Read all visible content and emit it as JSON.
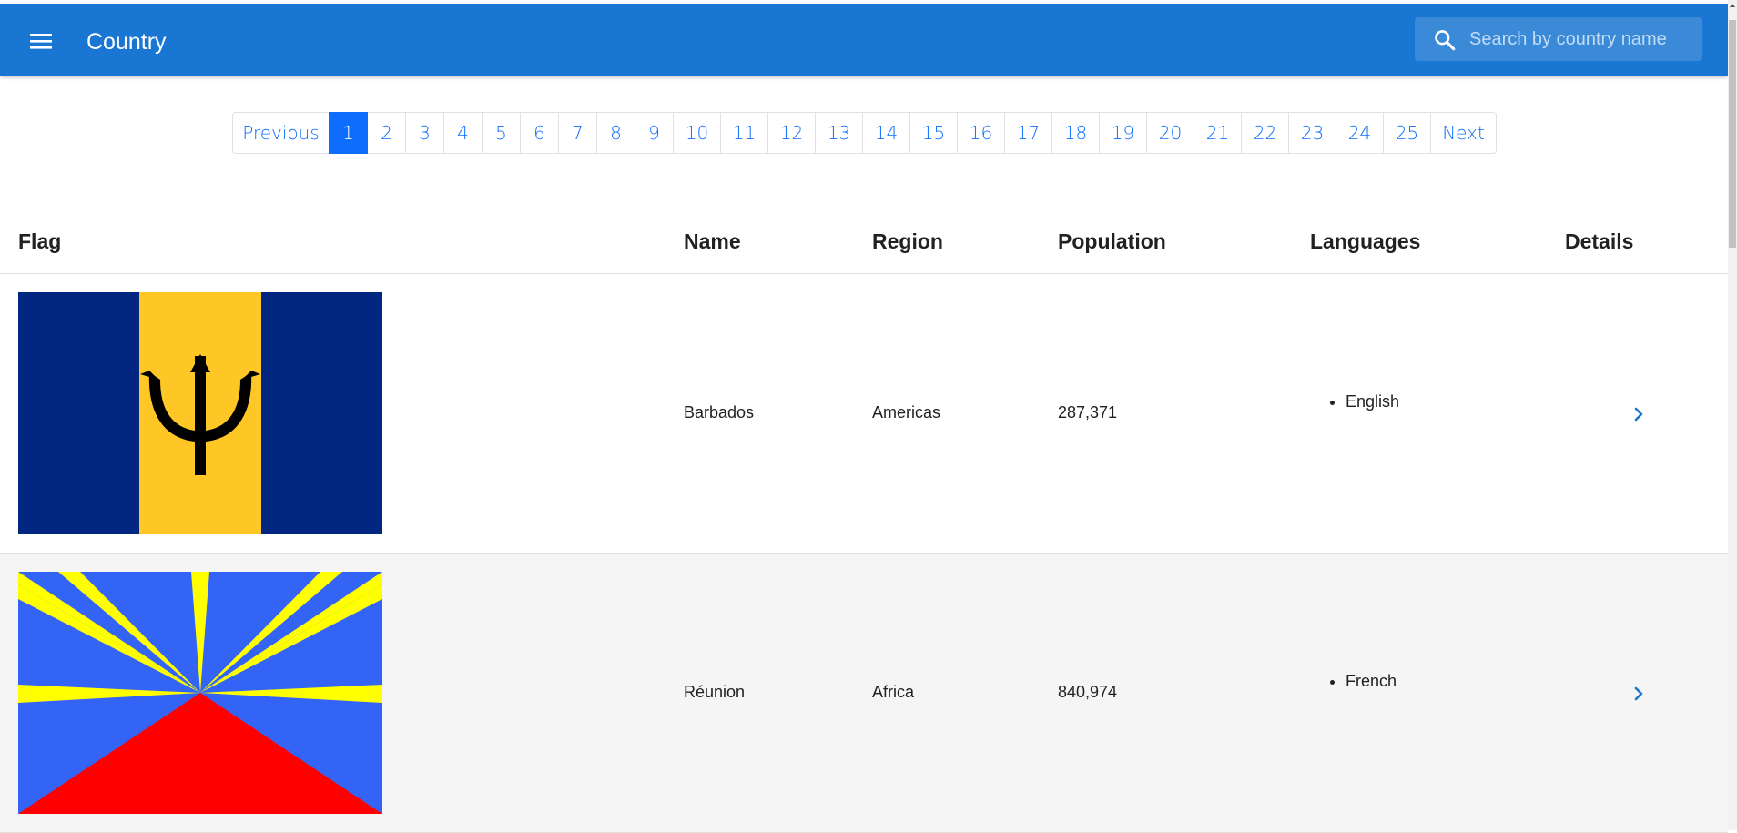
{
  "app": {
    "title": "Country",
    "menu_icon": "menu-icon",
    "search": {
      "placeholder": "Search by country name",
      "value": "",
      "icon": "search-icon"
    },
    "accent_color": "#1976d2"
  },
  "pagination": {
    "previous_label": "Previous",
    "next_label": "Next",
    "pages": [
      "1",
      "2",
      "3",
      "4",
      "5",
      "6",
      "7",
      "8",
      "9",
      "10",
      "11",
      "12",
      "13",
      "14",
      "15",
      "16",
      "17",
      "18",
      "19",
      "20",
      "21",
      "22",
      "23",
      "24",
      "25"
    ],
    "active_page": "1",
    "link_color": "#0d6efd"
  },
  "table": {
    "headers": {
      "flag": "Flag",
      "name": "Name",
      "region": "Region",
      "population": "Population",
      "languages": "Languages",
      "details": "Details"
    },
    "rows": [
      {
        "flag_icon": "barbados-flag",
        "name": "Barbados",
        "region": "Americas",
        "population": "287,371",
        "languages": [
          "English"
        ],
        "details_icon": "chevron-right-icon"
      },
      {
        "flag_icon": "reunion-flag",
        "name": "Réunion",
        "region": "Africa",
        "population": "840,974",
        "languages": [
          "French"
        ],
        "details_icon": "chevron-right-icon"
      }
    ]
  }
}
